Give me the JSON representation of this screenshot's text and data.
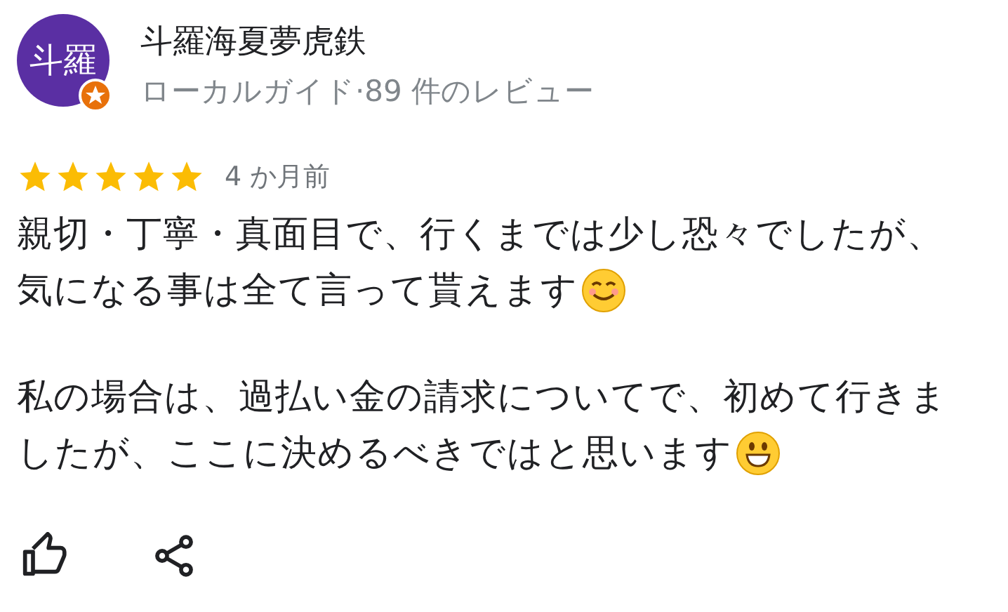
{
  "reviewer": {
    "avatar_text": "斗羅",
    "name": "斗羅海夏夢虎鉄",
    "subtitle": "ローカルガイド·89 件のレビュー",
    "local_guide_badge": true
  },
  "review": {
    "stars": 5,
    "time": "4 か月前",
    "paragraphs": [
      {
        "lines": [
          "親切・丁寧・真面目で、行くまでは少し恐々でしたが、",
          "気になる事は全て言って貰えます"
        ],
        "emoji": {
          "kind": "smile"
        }
      },
      {
        "lines": [
          "私の場合は、過払い金の請求についてで、初めて行きま",
          "したが、ここに決めるべきではと思います"
        ],
        "emoji": {
          "kind": "grin"
        }
      }
    ]
  }
}
